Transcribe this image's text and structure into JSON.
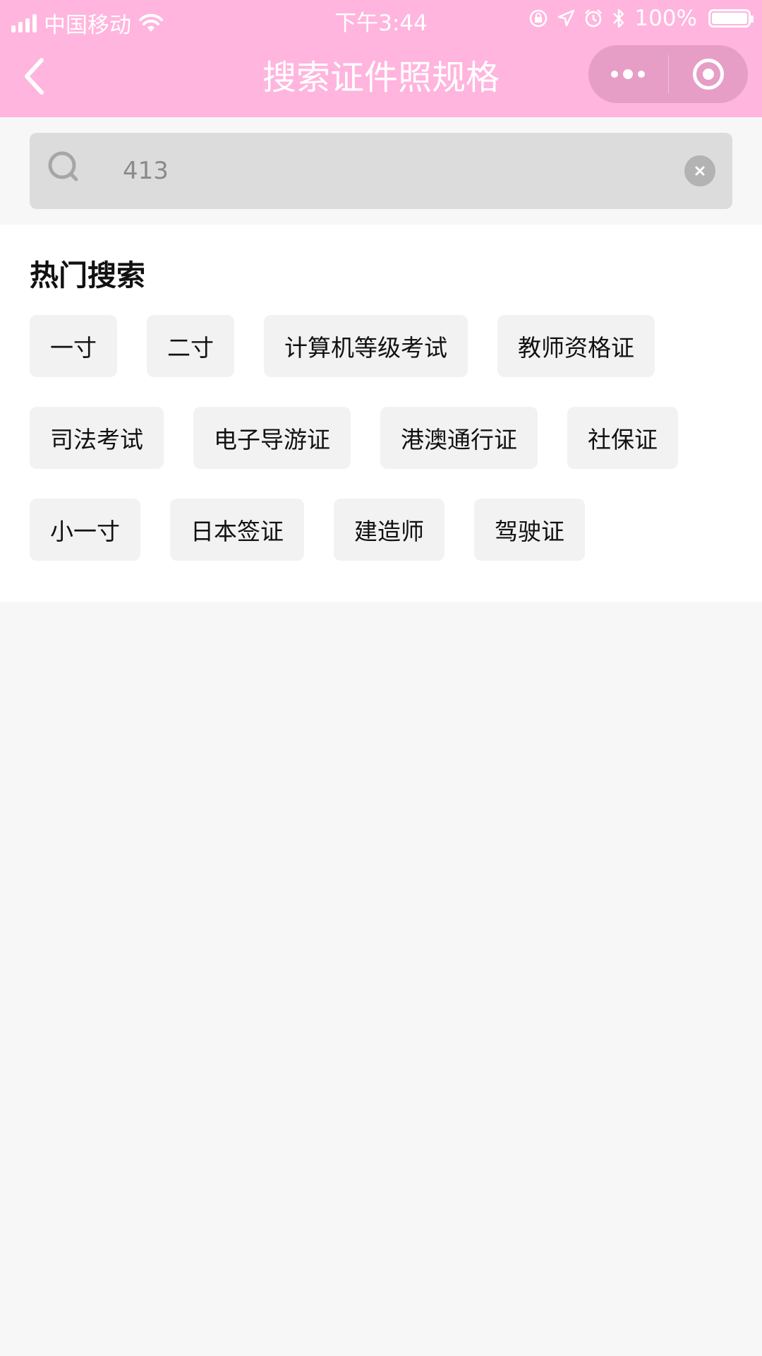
{
  "status_bar": {
    "carrier": "中国移动",
    "time": "下午3:44",
    "battery": "100%"
  },
  "nav": {
    "title": "搜索证件照规格"
  },
  "search": {
    "value": "413",
    "placeholder": ""
  },
  "hot": {
    "title": "热门搜索",
    "tags": [
      "一寸",
      "二寸",
      "计算机等级考试",
      "教师资格证",
      "司法考试",
      "电子导游证",
      "港澳通行证",
      "社保证",
      "小一寸",
      "日本签证",
      "建造师",
      "驾驶证"
    ]
  },
  "colors": {
    "header_bg": "#ffb5dd",
    "page_bg": "#f7f7f7",
    "search_bg": "#dcdcdc",
    "tag_bg": "#f2f2f2"
  },
  "icons": [
    "signal-icon",
    "wifi-icon",
    "lock-rotation-icon",
    "location-icon",
    "alarm-icon",
    "bluetooth-icon",
    "battery-icon",
    "back-chevron-icon",
    "more-dots-icon",
    "target-icon",
    "search-icon",
    "clear-icon"
  ]
}
